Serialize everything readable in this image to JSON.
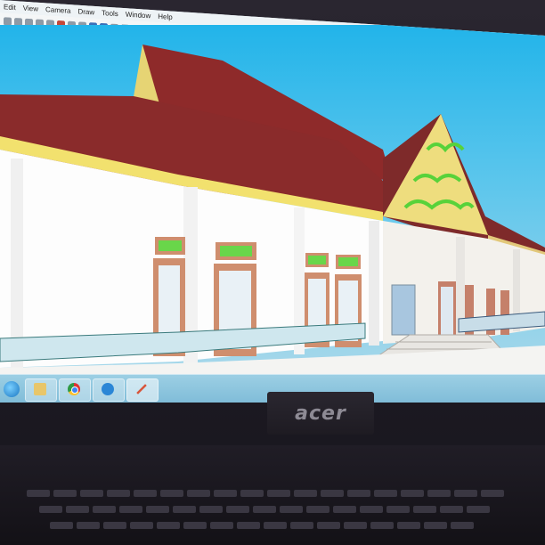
{
  "menubar": {
    "items": [
      "Edit",
      "View",
      "Camera",
      "Draw",
      "Tools",
      "Window",
      "Help"
    ]
  },
  "taskbar": {
    "apps": [
      "file-explorer",
      "chrome",
      "internet-explorer",
      "sketchup"
    ]
  },
  "tray": {
    "time": "",
    "date": ""
  },
  "bezel": {
    "logo": "acer"
  },
  "colors": {
    "sky_top": "#22b4ea",
    "roof": "#8a2c2c",
    "gable": "#e9dc7a",
    "wall": "#ffffff",
    "trim": "#e9d86a",
    "ornament": "#58d23a",
    "door": "#c98a6a"
  }
}
